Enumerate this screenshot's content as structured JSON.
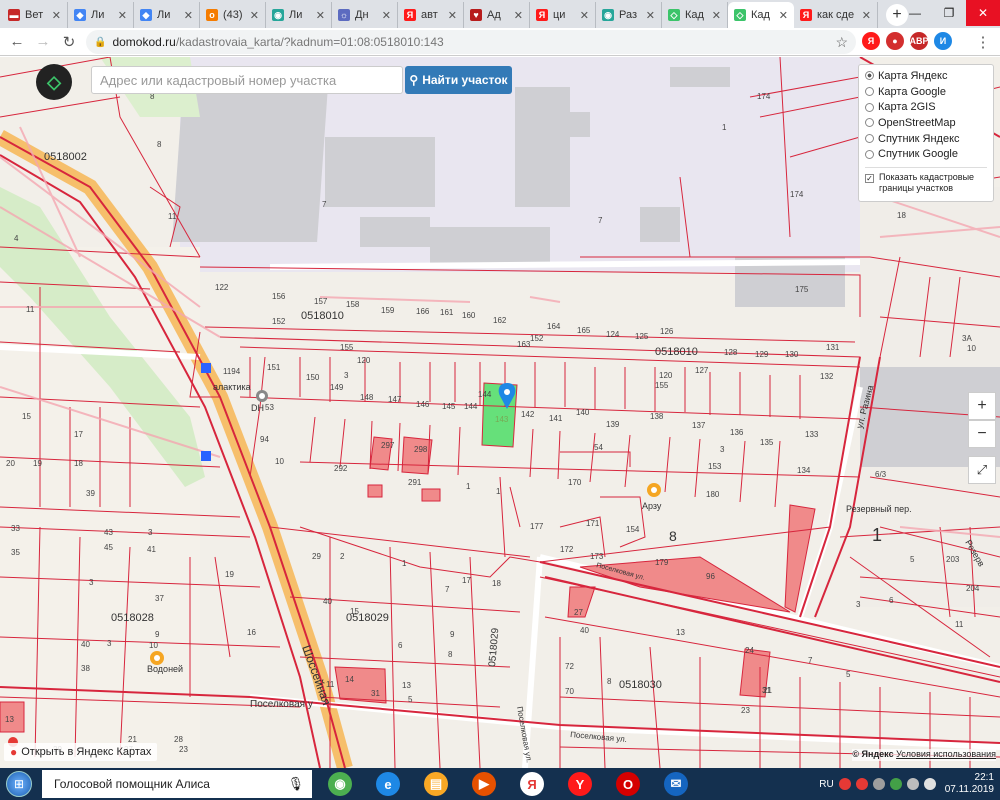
{
  "browser": {
    "tabs": [
      {
        "label": "Вет",
        "fav_color": "#c62828",
        "fav_glyph": "▬"
      },
      {
        "label": "Ли",
        "fav_color": "#4285f4",
        "fav_glyph": "◆"
      },
      {
        "label": "Ли",
        "fav_color": "#4285f4",
        "fav_glyph": "◆"
      },
      {
        "label": "(43)",
        "fav_color": "#f57c00",
        "fav_glyph": "о"
      },
      {
        "label": "Ли",
        "fav_color": "#26a69a",
        "fav_glyph": "◉"
      },
      {
        "label": "Дн",
        "fav_color": "#5c6bc0",
        "fav_glyph": "☼"
      },
      {
        "label": "авт",
        "fav_color": "#ff1a1a",
        "fav_glyph": "Я"
      },
      {
        "label": "Ад",
        "fav_color": "#b71c1c",
        "fav_glyph": "♥"
      },
      {
        "label": "ци",
        "fav_color": "#ff1a1a",
        "fav_glyph": "Я"
      },
      {
        "label": "Раз",
        "fav_color": "#26a69a",
        "fav_glyph": "◉"
      },
      {
        "label": "Кад",
        "fav_color": "#3cc46a",
        "fav_glyph": "◇"
      },
      {
        "label": "Кад",
        "fav_color": "#3cc46a",
        "fav_glyph": "◇",
        "active": true
      },
      {
        "label": "как сде",
        "fav_color": "#ff1a1a",
        "fav_glyph": "Я"
      }
    ],
    "new_tab_glyph": "+",
    "url_host": "domokod.ru",
    "url_path": "/kadastrovaia_karta/?kadnum=01:08:0518010:143",
    "extensions": [
      {
        "glyph": "Я",
        "color": "#ff1a1a"
      },
      {
        "glyph": "●",
        "color": "#d32f2f"
      },
      {
        "glyph": "ABP",
        "color": "#c62828"
      },
      {
        "glyph": "И",
        "color": "#1e88e5"
      }
    ],
    "colors": {
      "tabbar": "#dee1e6",
      "close": "#e81123"
    }
  },
  "map": {
    "search_placeholder": "Адрес или кадастровый номер участка",
    "find_button": "Найти участок",
    "layers": [
      {
        "label": "Карта Яндекс",
        "selected": true
      },
      {
        "label": "Карта Google",
        "selected": false
      },
      {
        "label": "Карта 2GIS",
        "selected": false
      },
      {
        "label": "OpenStreetMap",
        "selected": false
      },
      {
        "label": "Спутник Яндекс",
        "selected": false
      },
      {
        "label": "Спутник Google",
        "selected": false
      }
    ],
    "show_borders_label": "Показать кадастровые границы участков",
    "show_borders_checked": true,
    "zoom_in": "+",
    "zoom_out": "−",
    "fullscreen": "⤢",
    "open_in_yandex": "Открыть в Яндекс Картах",
    "copyright_prefix": "© Яндекс",
    "terms_link": "Условия использования",
    "highlighted_parcel": "143",
    "colors": {
      "parcel_border": "#d7263d",
      "selected_parcel": "#66e07a",
      "marker": "#1e88e5",
      "highway": "#f6bf6b",
      "button": "#337ab7"
    }
  },
  "taskbar": {
    "assistant": "Голосовой помощник Алиса",
    "lang": "RU",
    "time": "22:1",
    "date": "07.11.2019",
    "apps": [
      {
        "name": "chrome",
        "color": "#4caf50",
        "glyph": "◉"
      },
      {
        "name": "ie",
        "color": "#1e88e5",
        "glyph": "e"
      },
      {
        "name": "explorer",
        "color": "#f9a825",
        "glyph": "▤"
      },
      {
        "name": "media",
        "color": "#e65100",
        "glyph": "▶"
      },
      {
        "name": "yandex",
        "color": "#ffffff",
        "glyph": "Я"
      },
      {
        "name": "yandex-browser",
        "color": "#ff1a1a",
        "glyph": "Y"
      },
      {
        "name": "opera",
        "color": "#d50000",
        "glyph": "O"
      },
      {
        "name": "email",
        "color": "#1565c0",
        "glyph": "✉"
      }
    ]
  }
}
